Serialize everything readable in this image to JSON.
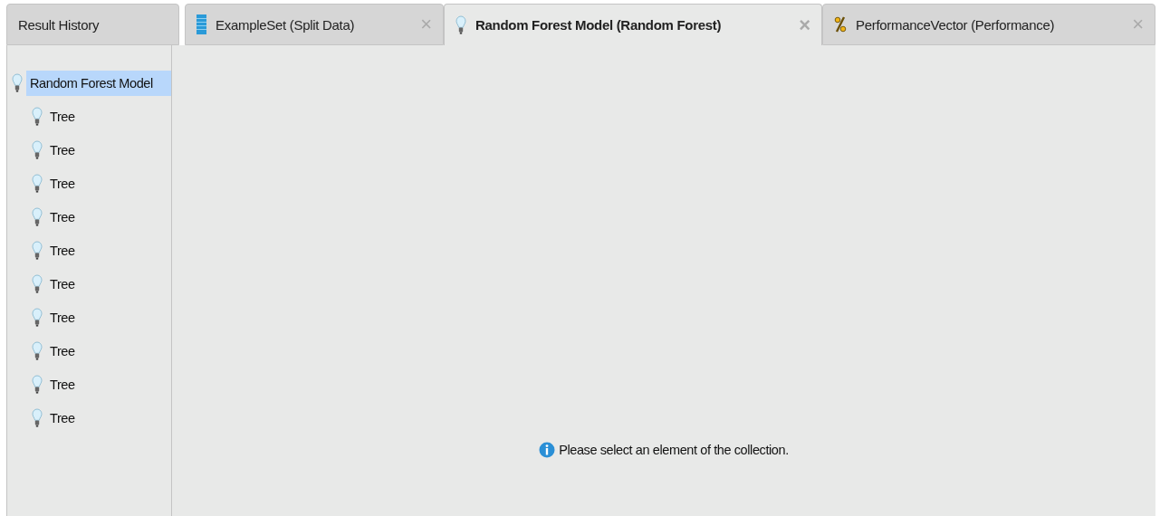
{
  "tabs": [
    {
      "label": "Result History",
      "kind": "history",
      "selected": false,
      "closable": false
    },
    {
      "label": "ExampleSet (Split Data)",
      "kind": "data",
      "selected": false,
      "closable": true
    },
    {
      "label": "Random Forest Model (Random Forest)",
      "kind": "model",
      "selected": true,
      "closable": true
    },
    {
      "label": "PerformanceVector (Performance)",
      "kind": "performance",
      "selected": false,
      "closable": true
    }
  ],
  "close_glyph": "×",
  "tree": {
    "label": "Random Forest Model",
    "selected": true,
    "children": [
      {
        "label": "Tree",
        "selected": false
      },
      {
        "label": "Tree",
        "selected": false
      },
      {
        "label": "Tree",
        "selected": false
      },
      {
        "label": "Tree",
        "selected": false
      },
      {
        "label": "Tree",
        "selected": false
      },
      {
        "label": "Tree",
        "selected": false
      },
      {
        "label": "Tree",
        "selected": false
      },
      {
        "label": "Tree",
        "selected": false
      },
      {
        "label": "Tree",
        "selected": false
      },
      {
        "label": "Tree",
        "selected": false
      }
    ]
  },
  "message": "Please select an element of the collection."
}
